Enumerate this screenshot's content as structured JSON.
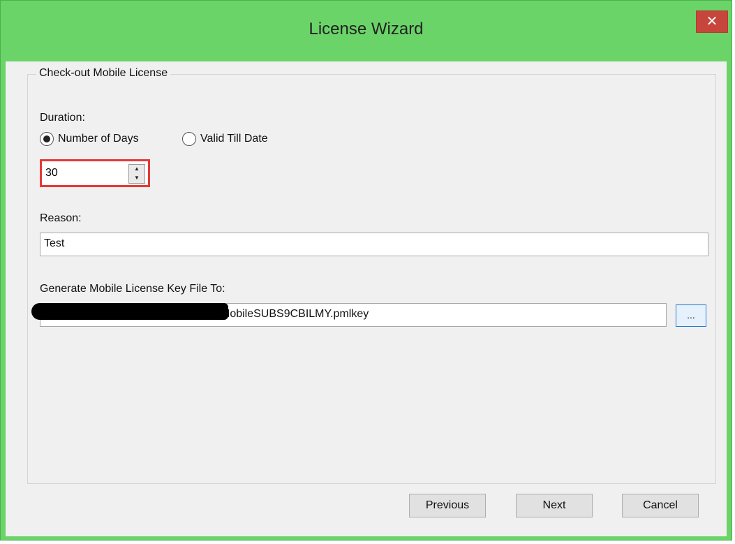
{
  "window": {
    "title": "License Wizard",
    "close_label": "✕"
  },
  "group": {
    "title": "Check-out Mobile License"
  },
  "duration": {
    "label": "Duration:",
    "option_days": "Number of Days",
    "option_date": "Valid Till Date",
    "selected": "Number of Days",
    "days_value": "30"
  },
  "reason": {
    "label": "Reason:",
    "value": "Test"
  },
  "output": {
    "label": "Generate Mobile License Key File To:",
    "path_visible": "MobileSUBS9CBILMY.pmlkey",
    "browse_label": "..."
  },
  "buttons": {
    "previous": "Previous",
    "next": "Next",
    "cancel": "Cancel"
  },
  "colors": {
    "titlebar": "#6ad468",
    "close": "#c7463c",
    "highlight": "#e53935"
  }
}
